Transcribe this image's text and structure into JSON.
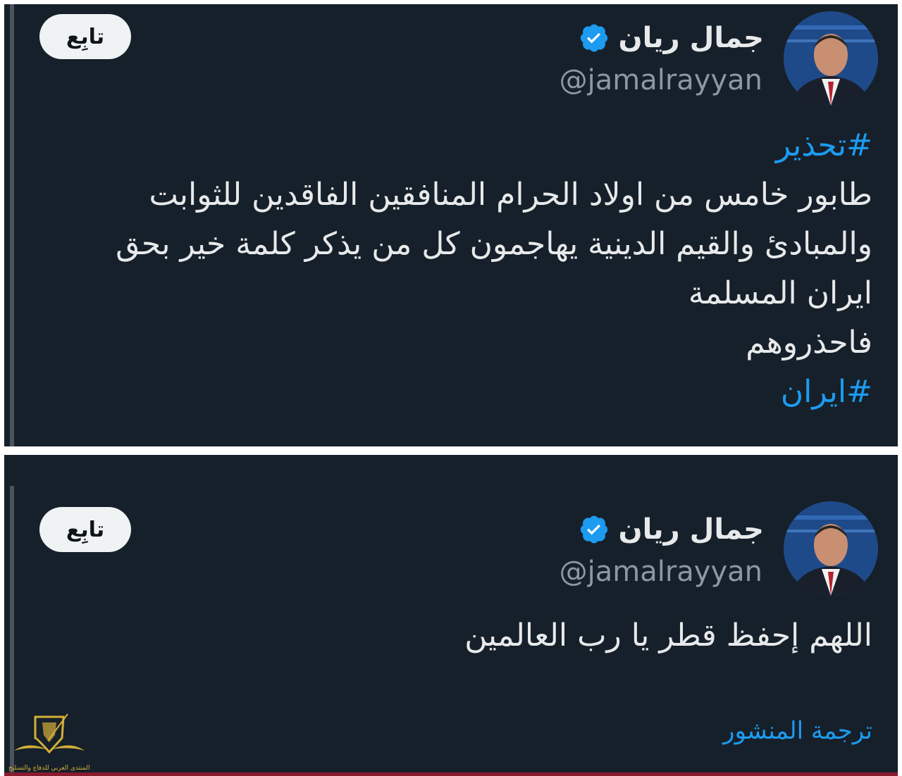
{
  "tweets": [
    {
      "author_name": "جمال ريان",
      "handle": "@jamalrayyan",
      "follow_label": "تابِع",
      "hashtag_top": "#تحذير",
      "lines": [
        "طابور خامس من اولاد الحرام المنافقين الفاقدين للثوابت",
        "والمبادئ والقيم الدينية يهاجمون كل من يذكر كلمة خير بحق",
        "ايران المسلمة",
        "فاحذروهم"
      ],
      "hashtag_bottom": "#ايران"
    },
    {
      "author_name": "جمال ريان",
      "handle": "@jamalrayyan",
      "follow_label": "تابِع",
      "text": "اللهم إحفظ قطر يا رب العالمين",
      "translate_label": "ترجمة المنشور"
    }
  ],
  "watermark": {
    "text": "المنتدى العربي للدفاع والتسليح"
  },
  "colors": {
    "background": "#16202a",
    "text": "#e7e9ea",
    "secondary": "#8b98a5",
    "accent": "#1d9bf0",
    "follow_bg": "#eff3f4"
  },
  "icons": [
    "verified-badge-icon",
    "avatar",
    "shield-logo-icon"
  ]
}
